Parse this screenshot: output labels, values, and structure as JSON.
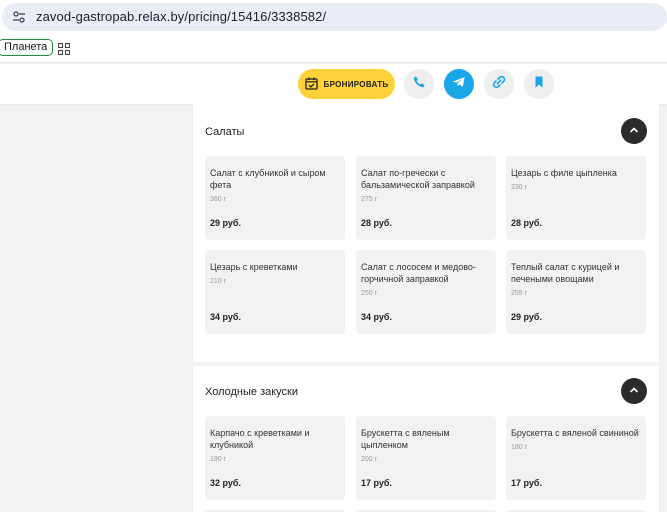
{
  "browser": {
    "url": "zavod-gastropab.relax.by/pricing/15416/3338582/"
  },
  "bookmarks": {
    "items": [
      {
        "label": "Планета"
      }
    ]
  },
  "header": {
    "book_label": "БРОНИРОВАТЬ",
    "colors": {
      "book": "#ffd23a",
      "telegram": "#1aa7e8",
      "icon_blue": "#1aa7e8"
    }
  },
  "sections": [
    {
      "title": "Салаты",
      "items": [
        {
          "name": "Салат с клубникой и сыром фета",
          "weight": "360 г",
          "price": "29 руб."
        },
        {
          "name": "Салат по-гречески с бальзамической заправкой",
          "weight": "275 г",
          "price": "28 руб."
        },
        {
          "name": "Цезарь с филе цыпленка",
          "weight": "230 г",
          "price": "28 руб."
        },
        {
          "name": "Цезарь с креветками",
          "weight": "210 г",
          "price": "34 руб."
        },
        {
          "name": "Салат с лососем и медово-горчичной заправкой",
          "weight": "250 г",
          "price": "34 руб."
        },
        {
          "name": "Теплый салат с курицей и печеными овощами",
          "weight": "255 г",
          "price": "29 руб."
        }
      ]
    },
    {
      "title": "Холодные закуски",
      "items": [
        {
          "name": "Карпачо с креветками и клубникой",
          "weight": "190 г",
          "price": "32 руб."
        },
        {
          "name": "Брускетта с вяленым цыпленком",
          "weight": "200 г",
          "price": "17 руб."
        },
        {
          "name": "Брускетта с вяленой свининой",
          "weight": "180 г",
          "price": "17 руб."
        }
      ]
    }
  ]
}
